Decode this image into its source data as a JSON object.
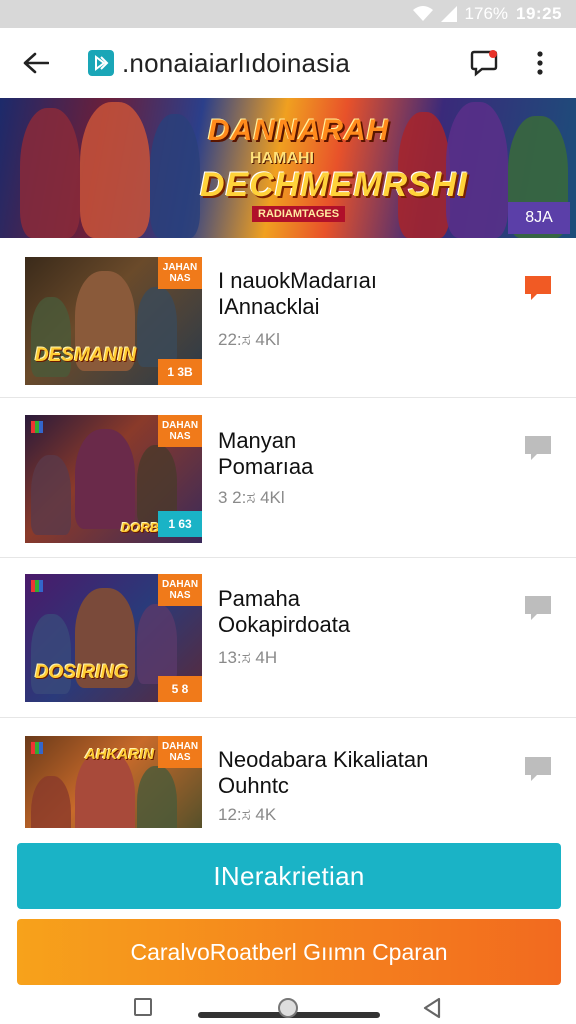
{
  "status_bar": {
    "battery": "176%",
    "time": "19:25"
  },
  "app_bar": {
    "title": ".nonaiaiarlıdoinasia"
  },
  "banner": {
    "title_line1": "DANNARAH",
    "title_line2": "HAMAHI",
    "title_main": "DECHMEMRSHI",
    "tag": "RADIAMTAGES",
    "count": "8JA"
  },
  "games": [
    {
      "title": "I nauokMadarıaı\nIAnnacklai",
      "meta": "22:ಸ 4Kl",
      "thumb_logo": "DESMANIN",
      "thumb_tag_top": "JAHAN\nNAS",
      "thumb_tag_bottom": "1 3B",
      "comment_active": true
    },
    {
      "title": "Manyan\nPomarıaa",
      "meta": "3 2:ಸ 4Kl",
      "thumb_logo": "DORBIAN",
      "thumb_tag_top": "DAHAN\nNAS",
      "thumb_tag_bottom": "1 63",
      "comment_active": false
    },
    {
      "title": "Pamaha\nOokapirdoata",
      "meta": "13:ಸ 4H",
      "thumb_logo": "DOSIRING",
      "thumb_tag_top": "DAHAN\nNAS",
      "thumb_tag_bottom": "5 8",
      "comment_active": false
    },
    {
      "title": "Neodabara Kikaliatan\nOuhntc",
      "meta": "12:ಸ 4K",
      "thumb_logo": "AHKARIN",
      "thumb_tag_top": "DAHAN\nNAS",
      "thumb_tag_bottom": "",
      "comment_active": false
    }
  ],
  "buttons": {
    "primary": "INerakrietian",
    "secondary": "CaralvoRoatberl Gıımn Cparan"
  },
  "colors": {
    "accent_teal": "#1ab3c6",
    "accent_orange": "#f26a1f",
    "comment_active": "#f15a24",
    "comment_inactive": "#bdbdbd"
  }
}
